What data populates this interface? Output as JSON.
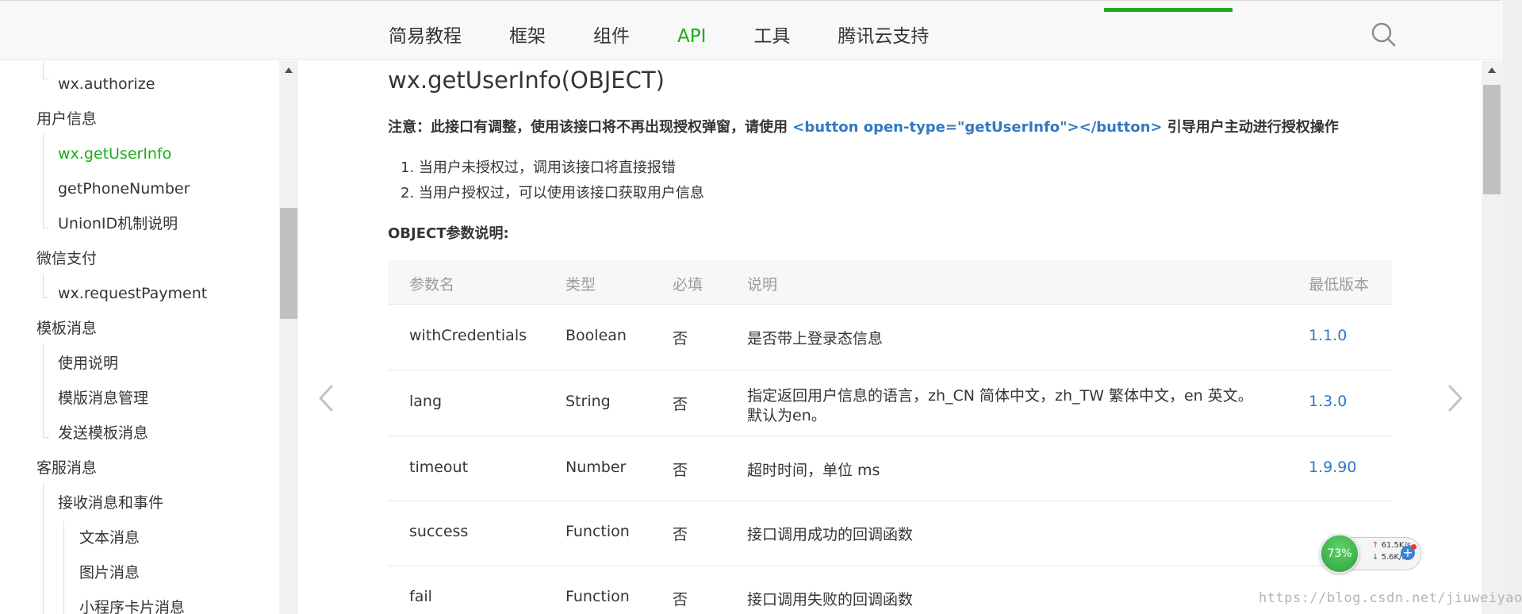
{
  "nav": {
    "items": [
      {
        "label": "简易教程"
      },
      {
        "label": "框架"
      },
      {
        "label": "组件"
      },
      {
        "label": "API"
      },
      {
        "label": "工具"
      },
      {
        "label": "腾讯云支持"
      }
    ],
    "active_label": "API",
    "search_icon": "search-icon"
  },
  "sidebar": {
    "items": [
      {
        "label": "wx.authorize"
      },
      {
        "label": "用户信息"
      },
      {
        "label": "wx.getUserInfo"
      },
      {
        "label": "getPhoneNumber"
      },
      {
        "label": "UnionID机制说明"
      },
      {
        "label": "微信支付"
      },
      {
        "label": "wx.requestPayment"
      },
      {
        "label": "模板消息"
      },
      {
        "label": "使用说明"
      },
      {
        "label": "模版消息管理"
      },
      {
        "label": "发送模板消息"
      },
      {
        "label": "客服消息"
      },
      {
        "label": "接收消息和事件"
      },
      {
        "label": "文本消息"
      },
      {
        "label": "图片消息"
      },
      {
        "label": "小程序卡片消息"
      }
    ],
    "active_label": "wx.getUserInfo"
  },
  "main": {
    "title": "wx.getUserInfo(OBJECT)",
    "notice_prefix": "注意：此接口有调整，使用该接口将不再出现授权弹窗，请使用",
    "notice_code": "<button open-type=\"getUserInfo\"></button>",
    "notice_suffix": "引导用户主动进行授权操作",
    "list": [
      "当用户未授权过，调用该接口将直接报错",
      "当用户授权过，可以使用该接口获取用户信息"
    ],
    "section_title": "OBJECT参数说明:",
    "table": {
      "headers": [
        "参数名",
        "类型",
        "必填",
        "说明",
        "最低版本"
      ],
      "rows": [
        {
          "name": "withCredentials",
          "type": "Boolean",
          "required": "否",
          "desc": "是否带上登录态信息",
          "desc2": "",
          "version": "1.1.0"
        },
        {
          "name": "lang",
          "type": "String",
          "required": "否",
          "desc": "指定返回用户信息的语言，zh_CN 简体中文，zh_TW 繁体中文，en 英文。",
          "desc2": "默认为en。",
          "version": "1.3.0"
        },
        {
          "name": "timeout",
          "type": "Number",
          "required": "否",
          "desc": "超时时间，单位 ms",
          "desc2": "",
          "version": "1.9.90"
        },
        {
          "name": "success",
          "type": "Function",
          "required": "否",
          "desc": "接口调用成功的回调函数",
          "desc2": "",
          "version": ""
        },
        {
          "name": "fail",
          "type": "Function",
          "required": "否",
          "desc": "接口调用失败的回调函数",
          "desc2": "",
          "version": ""
        }
      ]
    }
  },
  "widget": {
    "percent": "73%",
    "up": "61.5K/s",
    "down": "5.6K/s"
  },
  "watermark": "https://blog.csdn.net/jiuweiyaoy",
  "colors": {
    "accent_green": "#1aad19",
    "link_blue": "#3179c1",
    "text": "#353535",
    "muted": "#9b9b9b"
  }
}
